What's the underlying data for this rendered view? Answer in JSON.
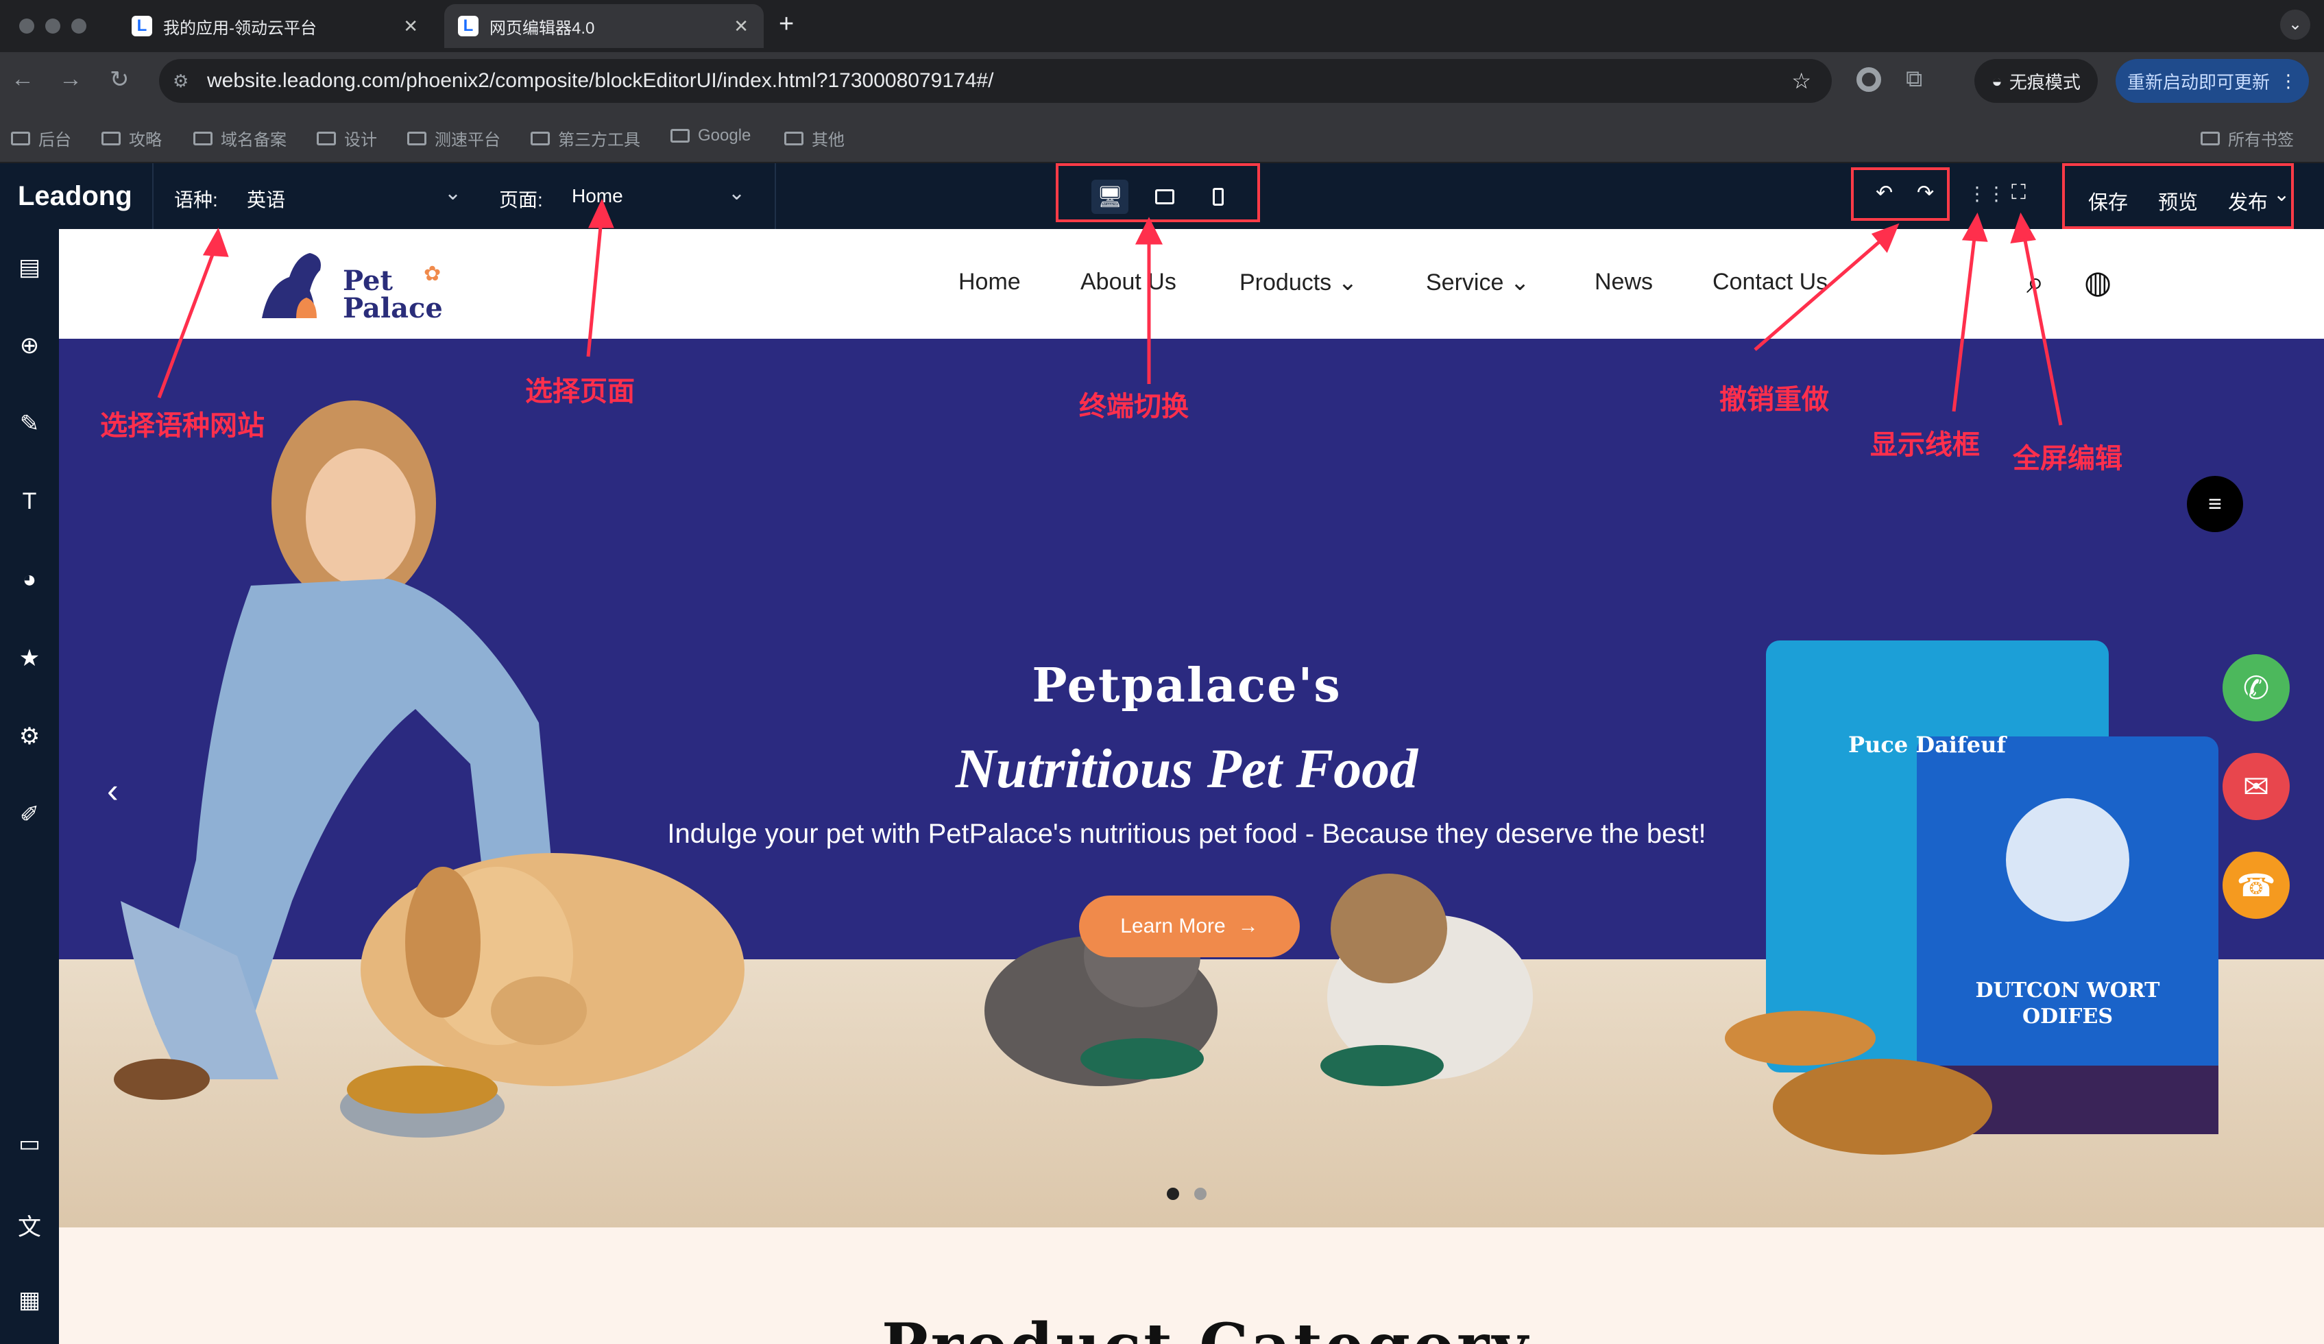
{
  "browser": {
    "tabs": [
      {
        "title": "我的应用-领动云平台"
      },
      {
        "title": "网页编辑器4.0"
      }
    ],
    "url": "website.leadong.com/phoenix2/composite/blockEditorUI/index.html?1730008079174#/",
    "incognito_label": "无痕模式",
    "update_label": "重新启动即可更新",
    "bookmarks": [
      "后台",
      "攻略",
      "域名备案",
      "设计",
      "测速平台",
      "第三方工具",
      "Google",
      "其他"
    ],
    "all_bookmarks": "所有书签"
  },
  "editor": {
    "brand": "Leadong",
    "language_label": "语种:",
    "language_value": "英语",
    "page_label": "页面:",
    "page_value": "Home",
    "actions": {
      "save": "保存",
      "preview": "预览",
      "publish": "发布"
    }
  },
  "site": {
    "logo_line1": "Pet",
    "logo_line2": "Palace",
    "menu": [
      "Home",
      "About Us",
      "Products",
      "Service",
      "News",
      "Contact Us"
    ],
    "hero": {
      "title1": "Petpalace's",
      "title2": "Nutritious Pet Food",
      "subtitle": "Indulge your pet with PetPalace's nutritious pet food - Because they deserve the best!",
      "cta": "Learn More"
    },
    "section_title": "Product Category",
    "packages": {
      "front_line1": "DUTCON WORT",
      "front_line2": "ODIFES",
      "back_line": "Puce Daifeuf"
    }
  },
  "annotations": {
    "language": "选择语种网站",
    "page": "选择页面",
    "device": "终端切换",
    "undo": "撤销重做",
    "wireframe": "显示线框",
    "fullscreen": "全屏编辑"
  },
  "colors": {
    "editor_bg": "#0d1b2e",
    "hero_bg": "#2b2a80",
    "accent": "#f08a4b",
    "annotation": "#ff2f4c"
  }
}
